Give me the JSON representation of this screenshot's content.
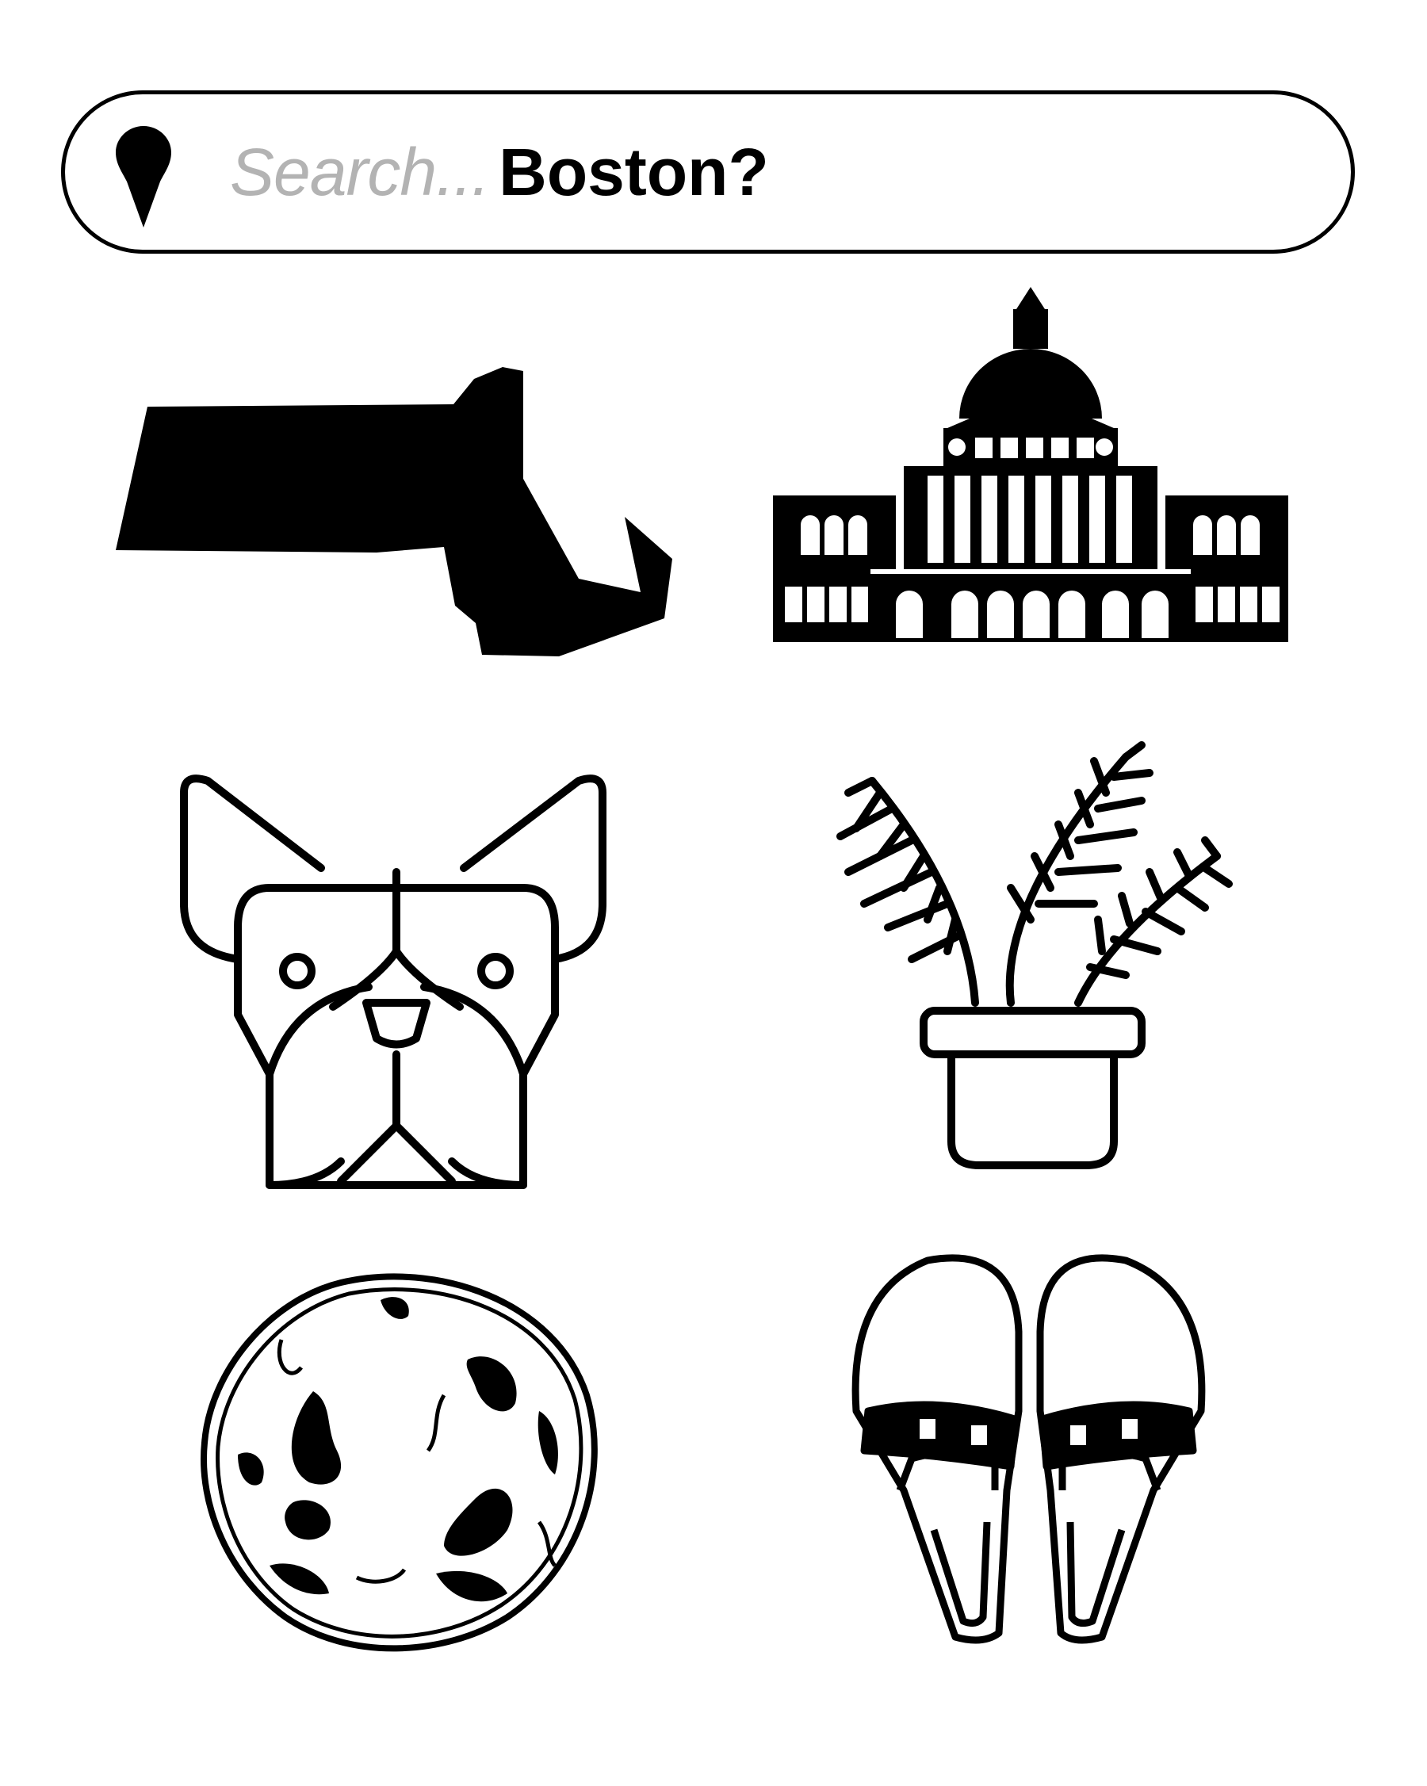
{
  "search": {
    "placeholder": "Search...",
    "query": "Boston?"
  },
  "icons": [
    "massachusetts-map-icon",
    "state-house-icon",
    "boston-terrier-icon",
    "fern-plant-icon",
    "cookie-icon",
    "sandals-icon"
  ]
}
